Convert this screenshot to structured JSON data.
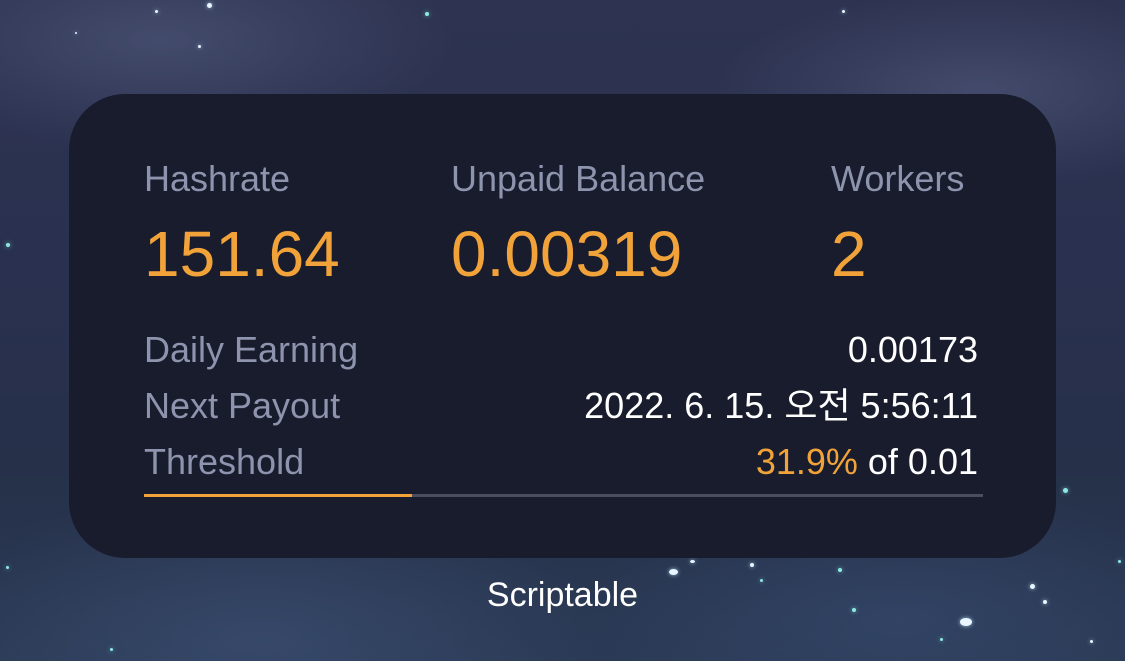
{
  "stats": {
    "hashrate": {
      "label": "Hashrate",
      "value": "151.64"
    },
    "unpaid_balance": {
      "label": "Unpaid Balance",
      "value": "0.00319"
    },
    "workers": {
      "label": "Workers",
      "value": "2"
    }
  },
  "details": {
    "daily_earning": {
      "label": "Daily Earning",
      "value": "0.00173"
    },
    "next_payout": {
      "label": "Next Payout",
      "value": "2022. 6. 15. 오전 5:56:11"
    },
    "threshold": {
      "label": "Threshold",
      "percent": "31.9%",
      "suffix": " of 0.01"
    }
  },
  "threshold_progress": 0.319,
  "app_name": "Scriptable",
  "colors": {
    "accent": "#f1a33a",
    "widget_background": "#181c2d",
    "label": "#8e94ad",
    "value": "#ffffff"
  }
}
